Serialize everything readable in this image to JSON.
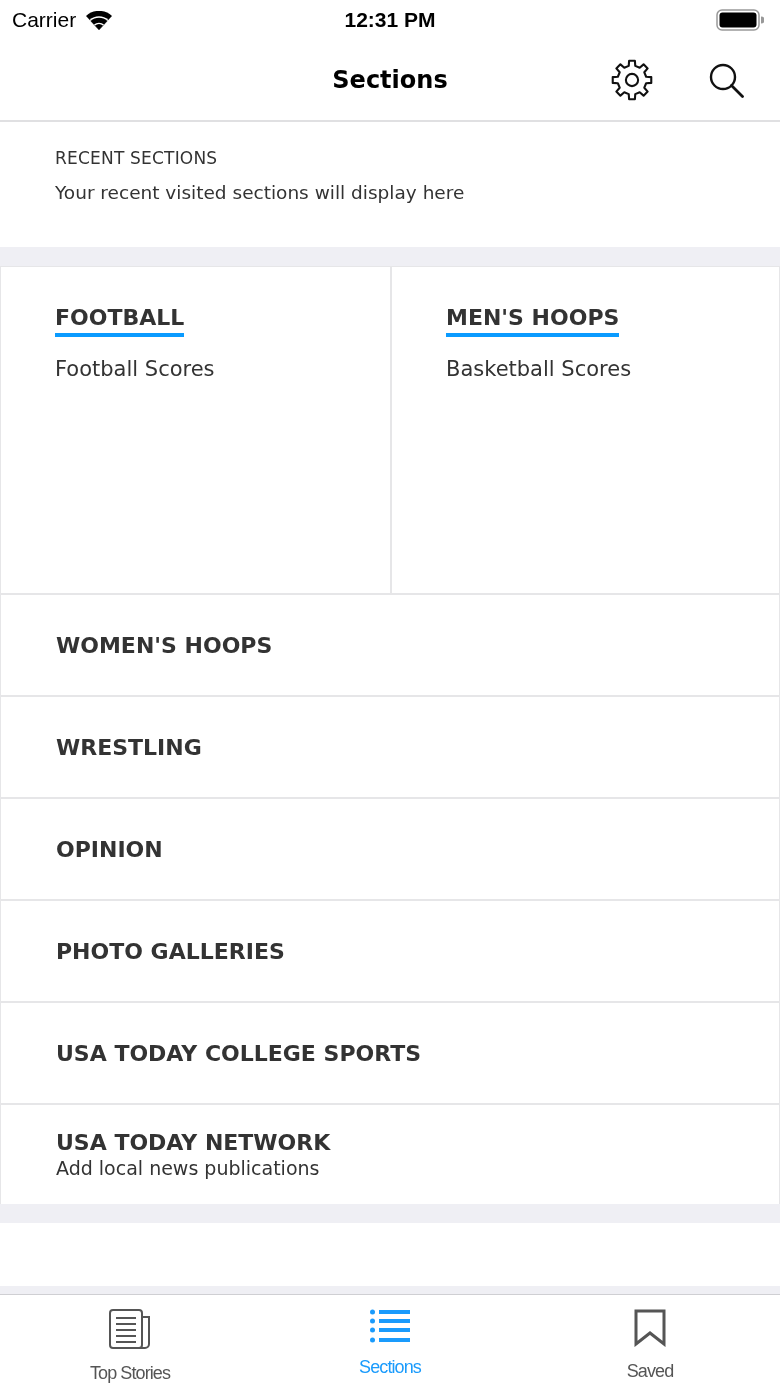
{
  "status_bar": {
    "carrier": "Carrier",
    "time": "12:31 PM"
  },
  "nav_bar": {
    "title": "Sections"
  },
  "recent": {
    "heading": "RECENT SECTIONS",
    "message": "Your recent visited sections will display here"
  },
  "featured": [
    {
      "title": "FOOTBALL",
      "subtitle": "Football Scores"
    },
    {
      "title": "MEN'S HOOPS",
      "subtitle": "Basketball Scores"
    }
  ],
  "sections": [
    {
      "title": "WOMEN'S HOOPS"
    },
    {
      "title": "WRESTLING"
    },
    {
      "title": "OPINION"
    },
    {
      "title": "PHOTO GALLERIES"
    },
    {
      "title": "USA TODAY COLLEGE SPORTS"
    },
    {
      "title": "USA TODAY NETWORK",
      "subtitle": "Add local news publications"
    }
  ],
  "tab_bar": [
    {
      "label": "Top Stories",
      "selected": false
    },
    {
      "label": "Sections",
      "selected": true
    },
    {
      "label": "Saved",
      "selected": false
    }
  ]
}
